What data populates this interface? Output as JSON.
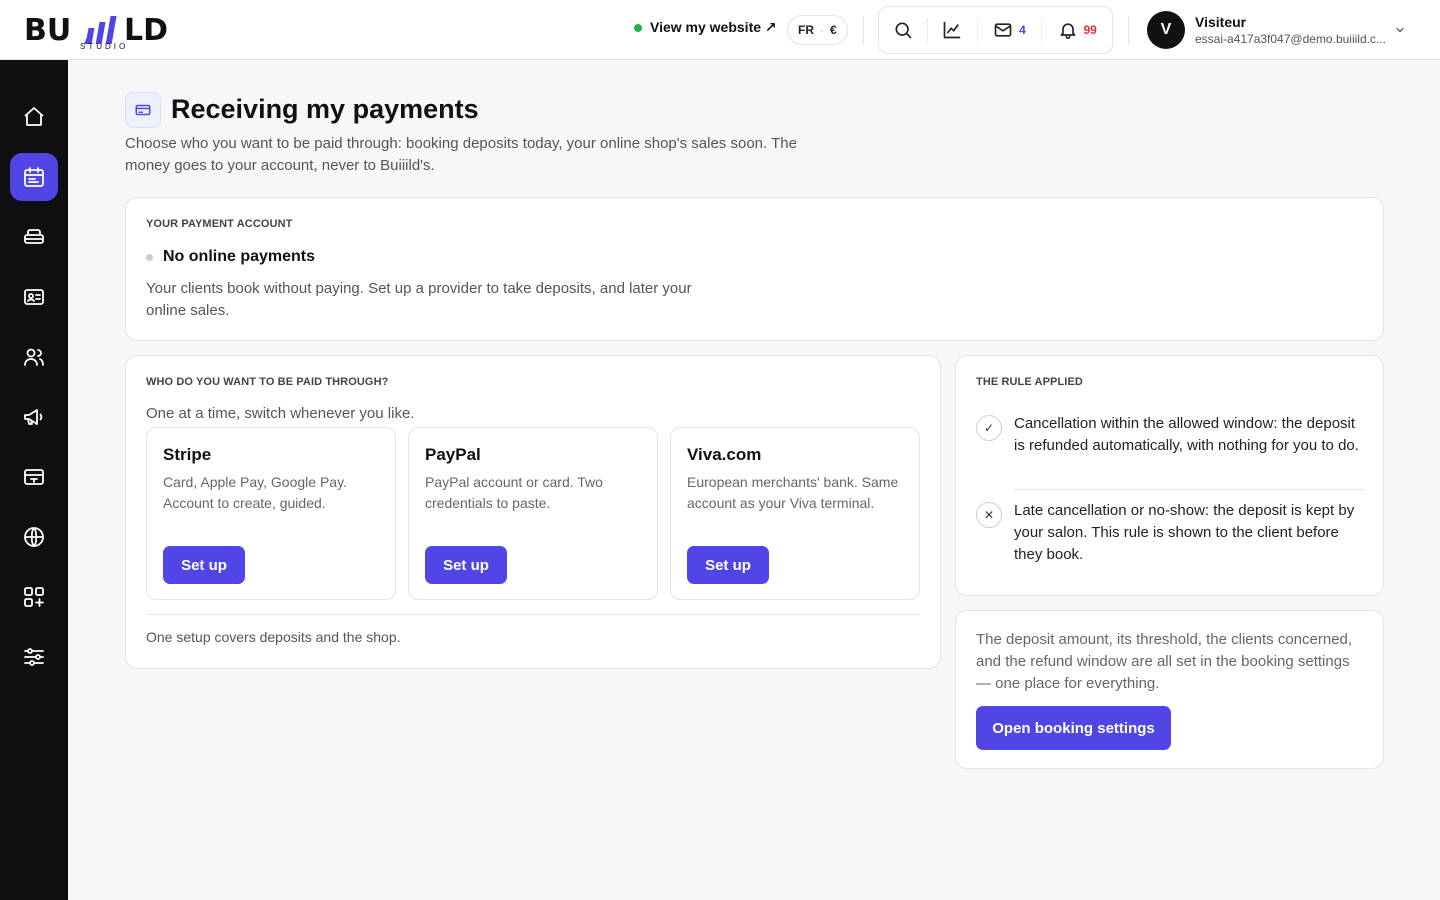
{
  "brand": {
    "logo_text": "BUIILD",
    "logo_sub": "STUDIO"
  },
  "header": {
    "view_site_label": "View my website ↗",
    "locale": "FR",
    "currency": "€",
    "messages_count": "4",
    "notifications_count": "99",
    "user": {
      "initial": "V",
      "name": "Visiteur",
      "email": "essai-a417a3f047@demo.buiiild.c..."
    }
  },
  "sidebar": {
    "items": [
      {
        "name": "home",
        "active": false
      },
      {
        "name": "calendar",
        "active": true
      },
      {
        "name": "services",
        "active": false
      },
      {
        "name": "contacts-card",
        "active": false
      },
      {
        "name": "team",
        "active": false
      },
      {
        "name": "marketing",
        "active": false
      },
      {
        "name": "payments",
        "active": false
      },
      {
        "name": "website",
        "active": false
      },
      {
        "name": "apps",
        "active": false
      },
      {
        "name": "settings",
        "active": false
      }
    ]
  },
  "page": {
    "title": "Receiving my payments",
    "subtitle": "Choose who you want to be paid through: booking deposits today, your online shop's sales soon. The money goes to your account, never to Buiiild's."
  },
  "account": {
    "eyebrow": "YOUR PAYMENT ACCOUNT",
    "status": "No online payments",
    "description": "Your clients book without paying. Set up a provider to take deposits, and later your online sales."
  },
  "providers": {
    "eyebrow": "WHO DO YOU WANT TO BE PAID THROUGH?",
    "hint": "One at a time, switch whenever you like.",
    "items": [
      {
        "name": "Stripe",
        "description": "Card, Apple Pay, Google Pay. Account to create, guided.",
        "button": "Set up"
      },
      {
        "name": "PayPal",
        "description": "PayPal account or card. Two credentials to paste.",
        "button": "Set up"
      },
      {
        "name": "Viva.com",
        "description": "European merchants' bank. Same account as your Viva terminal.",
        "button": "Set up"
      }
    ],
    "footer": "One setup covers deposits and the shop."
  },
  "rule": {
    "eyebrow": "THE RULE APPLIED",
    "items": [
      {
        "icon": "✓",
        "text": "Cancellation within the allowed window: the deposit is refunded automatically, with nothing for you to do."
      },
      {
        "icon": "✕",
        "text": "Late cancellation or no-show: the deposit is kept by your salon. This rule is shown to the client before they book."
      }
    ]
  },
  "settings": {
    "text": "The deposit amount, its threshold, the clients concerned, and the refund window are all set in the booking settings — one place for everything.",
    "button": "Open booking settings"
  },
  "colors": {
    "accent": "#4f46e5",
    "sidebar": "#0f0f12",
    "online": "#1bb34a",
    "alert": "#e0312f"
  }
}
